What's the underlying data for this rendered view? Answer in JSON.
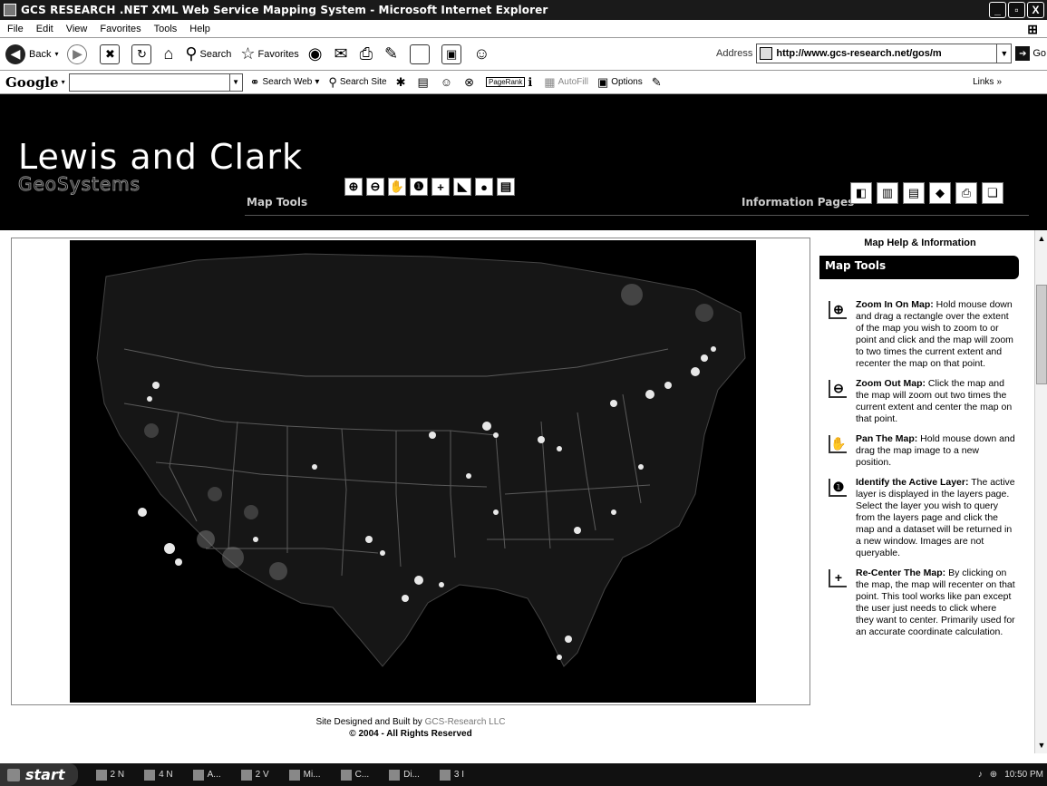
{
  "window": {
    "title": "GCS RESEARCH .NET XML Web Service Mapping System - Microsoft Internet Explorer",
    "buttons": [
      "_",
      "▫",
      "X"
    ]
  },
  "menu": [
    "File",
    "Edit",
    "View",
    "Favorites",
    "Tools",
    "Help"
  ],
  "toolbar": {
    "back": "Back",
    "search": "Search",
    "favorites": "Favorites",
    "address_label": "Address",
    "address_value": "http://www.gcs-research.net/gos/m",
    "go": "Go"
  },
  "google_bar": {
    "logo": "Google",
    "search_web": "Search Web",
    "search_site": "Search Site",
    "pagerank": "PageRank",
    "autofill": "AutoFill",
    "options": "Options",
    "links": "Links"
  },
  "site": {
    "brand_name": "Lewis and Clark",
    "brand_sub": "GeoSystems",
    "map_tools_label": "Map Tools",
    "info_pages_label": "Information Pages",
    "footer_credit": "Site Designed and Built by",
    "footer_company": "GCS-Research LLC",
    "footer_copyright": "© 2004 - All Rights Reserved"
  },
  "help": {
    "title": "Map Help & Information",
    "tab": "Map Tools",
    "items": [
      {
        "icon": "zoom-in-icon",
        "glyph": "⊕",
        "title": "Zoom In On Map:",
        "text": " Hold mouse down and drag a rectangle over the extent of the map you wish to zoom to or point and click and the map will zoom to two times the current extent and recenter the map on that point."
      },
      {
        "icon": "zoom-out-icon",
        "glyph": "⊖",
        "title": "Zoom Out Map:",
        "text": " Click the map and the map will zoom out two times the current extent and center the map on that point."
      },
      {
        "icon": "pan-hand-icon",
        "glyph": "✋",
        "title": "Pan The Map:",
        "text": " Hold mouse down and drag the map image to a new position."
      },
      {
        "icon": "identify-icon",
        "glyph": "❶",
        "title": "Identify the Active Layer:",
        "text": " The active layer is displayed in the layers page. Select the layer you wish to query from the layers page and click the map and a dataset will be returned in a new window. Images are not queryable."
      },
      {
        "icon": "recenter-icon",
        "glyph": "+",
        "title": "Re-Center The Map:",
        "text": " By clicking on the map, the map will recenter on that point. This tool works like pan except the user just needs to click where they want to center. Primarily used for an accurate coordinate calculation."
      }
    ]
  },
  "taskbar": {
    "start": "start",
    "tasks": [
      "2 N",
      "4 N",
      "A...",
      "2 V",
      "Mi...",
      "C...",
      "Di...",
      "3 I"
    ],
    "clock": "10:50 PM"
  }
}
